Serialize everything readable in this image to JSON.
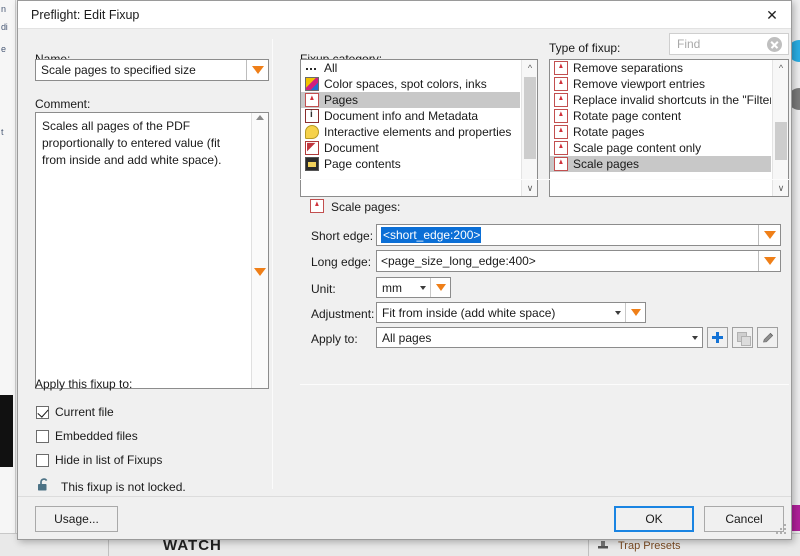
{
  "dialog": {
    "title": "Preflight: Edit Fixup",
    "close_icon": "close-icon"
  },
  "left": {
    "name_label": "Name:",
    "name_value": "Scale pages to specified size",
    "comment_label": "Comment:",
    "comment_text": "Scales all pages of the PDF proportionally to entered value (fit from inside and add white space).",
    "apply_label": "Apply this fixup to:",
    "checkboxes": [
      {
        "label": "Current file",
        "checked": true
      },
      {
        "label": "Embedded files",
        "checked": false
      },
      {
        "label": "Hide in list of Fixups",
        "checked": false
      }
    ],
    "lock_icon": "unlocked-padlock-icon",
    "lock_text": "This fixup is not locked.",
    "usage_button": "Usage..."
  },
  "category": {
    "label": "Fixup category:",
    "items": [
      {
        "label": "All",
        "icon": "dots-icon",
        "selected": false
      },
      {
        "label": "Color spaces, spot colors, inks",
        "icon": "color-swatch-icon",
        "selected": false
      },
      {
        "label": "Pages",
        "icon": "pdf-page-icon",
        "selected": true
      },
      {
        "label": "Document info and Metadata",
        "icon": "document-info-icon",
        "selected": false
      },
      {
        "label": "Interactive elements and properties",
        "icon": "comment-bubble-icon",
        "selected": false
      },
      {
        "label": "Document",
        "icon": "pdf-document-icon",
        "selected": false
      },
      {
        "label": "Page contents",
        "icon": "page-contents-icon",
        "selected": false
      }
    ]
  },
  "fixup_type": {
    "label": "Type of fixup:",
    "find_placeholder": "Find",
    "find_value": "",
    "clear_icon": "clear-circle-icon",
    "items": [
      {
        "label": "Remove separations",
        "icon": "pdf-page-icon",
        "selected": false
      },
      {
        "label": "Remove viewport entries",
        "icon": "pdf-page-icon",
        "selected": false
      },
      {
        "label": "Replace invalid shortcuts in the \"Filter\" entr",
        "icon": "pdf-page-icon",
        "selected": false
      },
      {
        "label": "Rotate page content",
        "icon": "pdf-page-icon",
        "selected": false
      },
      {
        "label": "Rotate pages",
        "icon": "pdf-page-icon",
        "selected": false
      },
      {
        "label": "Scale page content only",
        "icon": "pdf-page-icon",
        "selected": false
      },
      {
        "label": "Scale pages",
        "icon": "pdf-page-icon",
        "selected": true
      }
    ]
  },
  "settings": {
    "panel_title": "Scale pages:",
    "panel_icon": "pdf-page-icon",
    "short_edge_label": "Short edge:",
    "short_edge_value": "<short_edge:200>",
    "long_edge_label": "Long edge:",
    "long_edge_value": "<page_size_long_edge:400>",
    "unit_label": "Unit:",
    "unit_value": "mm",
    "adjustment_label": "Adjustment:",
    "adjustment_value": "Fit from inside (add white space)",
    "apply_to_label": "Apply to:",
    "apply_to_value": "All pages",
    "add_icon": "plus-icon",
    "duplicate_icon": "duplicate-icon",
    "edit_icon": "pencil-icon"
  },
  "footer": {
    "ok_label": "OK",
    "cancel_label": "Cancel"
  },
  "background": {
    "watch_text": "WATCH",
    "trap_presets": "Trap Presets",
    "edge_texts": [
      "n",
      "di",
      "e",
      "t"
    ]
  },
  "colors": {
    "accent_orange": "#ef7f18",
    "selection_blue": "#0b6fd6",
    "default_button_border": "#1a84e2",
    "list_selection": "#c8c8c8"
  }
}
